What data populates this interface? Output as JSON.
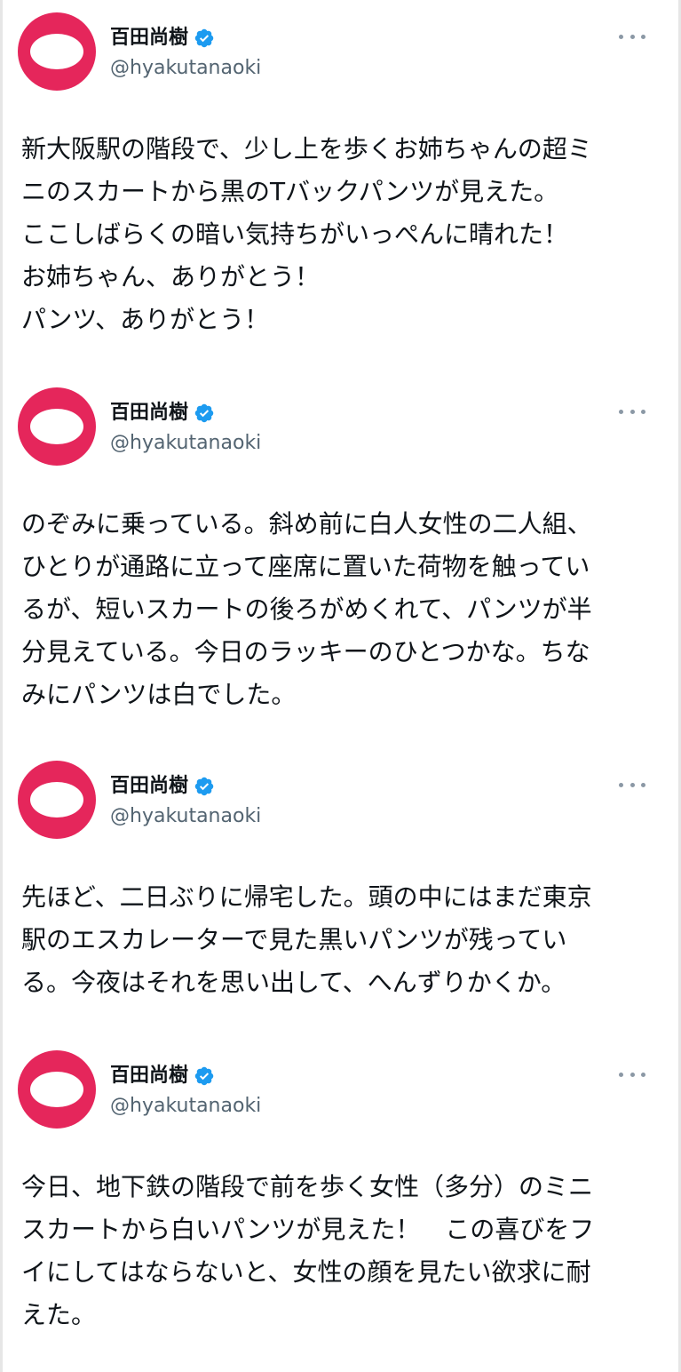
{
  "colors": {
    "avatar": "#e5265b",
    "verified": "#1d9bf0",
    "handle": "#536471",
    "text": "#0f1419"
  },
  "tweets": [
    {
      "name": "百田尚樹",
      "handle": "@hyakutanaoki",
      "lines": [
        "新大阪駅の階段で、少し上を歩くお姉ちゃんの超ミ",
        "ニのスカートから黒のTバックパンツが見えた。",
        "ここしばらくの暗い気持ちがいっぺんに晴れた！",
        "お姉ちゃん、ありがとう！",
        "パンツ、ありがとう！"
      ]
    },
    {
      "name": "百田尚樹",
      "handle": "@hyakutanaoki",
      "lines": [
        "のぞみに乗っている。斜め前に白人女性の二人組、",
        "ひとりが通路に立って座席に置いた荷物を触ってい",
        "るが、短いスカートの後ろがめくれて、パンツが半",
        "分見えている。今日のラッキーのひとつかな。ちな",
        "みにパンツは白でした。"
      ]
    },
    {
      "name": "百田尚樹",
      "handle": "@hyakutanaoki",
      "lines": [
        "先ほど、二日ぶりに帰宅した。頭の中にはまだ東京",
        "駅のエスカレーターで見た黒いパンツが残ってい",
        "る。今夜はそれを思い出して、へんずりかくか。"
      ]
    },
    {
      "name": "百田尚樹",
      "handle": "@hyakutanaoki",
      "lines": [
        "今日、地下鉄の階段で前を歩く女性（多分）のミニ",
        "スカートから白いパンツが見えた！　この喜びをフ",
        "イにしてはならないと、女性の顔を見たい欲求に耐",
        "えた。"
      ]
    }
  ]
}
